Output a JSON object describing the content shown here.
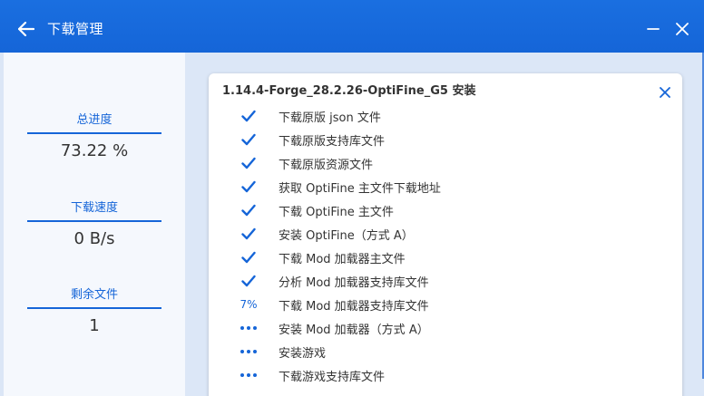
{
  "window": {
    "title": "下载管理"
  },
  "sidebar": {
    "progress_label": "总进度",
    "progress_value": "73.22 %",
    "speed_label": "下载速度",
    "speed_value": "0 B/s",
    "remaining_label": "剩余文件",
    "remaining_value": "1"
  },
  "card": {
    "title": "1.14.4-Forge_28.2.26-OptiFine_G5 安装",
    "tasks": [
      {
        "status": "done",
        "name": "下载原版 json 文件"
      },
      {
        "status": "done",
        "name": "下载原版支持库文件"
      },
      {
        "status": "done",
        "name": "下载原版资源文件"
      },
      {
        "status": "done",
        "name": "获取 OptiFine 主文件下载地址"
      },
      {
        "status": "done",
        "name": "下载 OptiFine 主文件"
      },
      {
        "status": "done",
        "name": "安装 OptiFine（方式 A）"
      },
      {
        "status": "done",
        "name": "下载 Mod 加载器主文件"
      },
      {
        "status": "done",
        "name": "分析 Mod 加载器支持库文件"
      },
      {
        "status": "progress",
        "progress_text": "7%",
        "name": "下载 Mod 加载器支持库文件"
      },
      {
        "status": "waiting",
        "name": "安装 Mod 加载器（方式 A）"
      },
      {
        "status": "waiting",
        "name": "安装游戏"
      },
      {
        "status": "waiting",
        "name": "下载游戏支持库文件"
      }
    ]
  },
  "colors": {
    "accent": "#1565d8",
    "titlebar": "#1a6fe0",
    "main_bg": "#dce7f7"
  }
}
